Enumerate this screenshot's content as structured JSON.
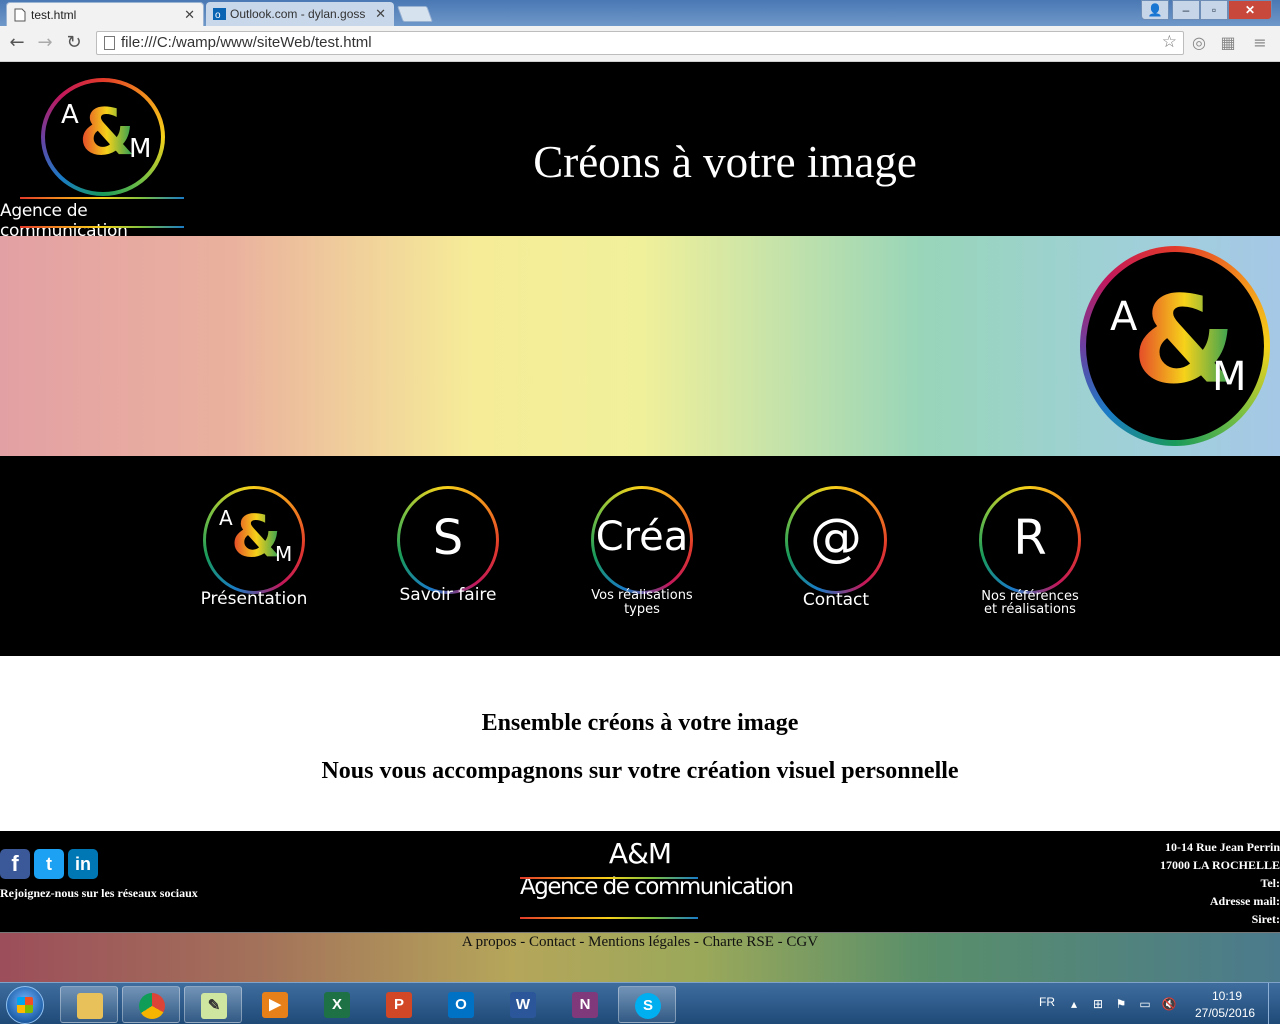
{
  "browser": {
    "tabs": [
      {
        "title": "test.html",
        "active": true
      },
      {
        "title": "Outlook.com - dylan.goss",
        "active": false
      }
    ],
    "url": "file:///C:/wamp/www/siteWeb/test.html"
  },
  "header": {
    "logo_letter_a": "A",
    "logo_ampersand": "&",
    "logo_letter_m": "M",
    "logo_tagline": "Agence de communication",
    "title": "Créons à votre image"
  },
  "nav": {
    "items": [
      {
        "glyph": "A&M",
        "label": "Présentation"
      },
      {
        "glyph": "S",
        "label": "Savoir faire"
      },
      {
        "glyph": "Créa",
        "label_line1": "Vos réalisations",
        "label_line2": "types"
      },
      {
        "glyph": "@",
        "label": "Contact"
      },
      {
        "glyph": "R",
        "label_line1": "Nos références",
        "label_line2": "et réalisations"
      }
    ]
  },
  "content": {
    "heading1": "Ensemble créons à votre image",
    "heading2": "Nous vous accompagnons sur votre création visuel personnelle"
  },
  "footer": {
    "social_text": "Rejoignez-nous sur les réseaux sociaux",
    "brand_name": "A&M",
    "brand_tagline": "Agence de communication",
    "address": {
      "street": "10-14 Rue Jean Perrin",
      "city": "17000 LA ROCHELLE",
      "tel": "Tel:",
      "email": "Adresse mail:",
      "siret": "Siret:"
    },
    "links": "A propos - Contact - Mentions légales - Charte RSE - CGV"
  },
  "taskbar": {
    "language": "FR",
    "time": "10:19",
    "date": "27/05/2016"
  },
  "colors": {
    "header_bg": "#000000",
    "banner_start": "#e3a0a4",
    "banner_mid": "#f6ec98",
    "banner_end": "#a5c8e6"
  }
}
